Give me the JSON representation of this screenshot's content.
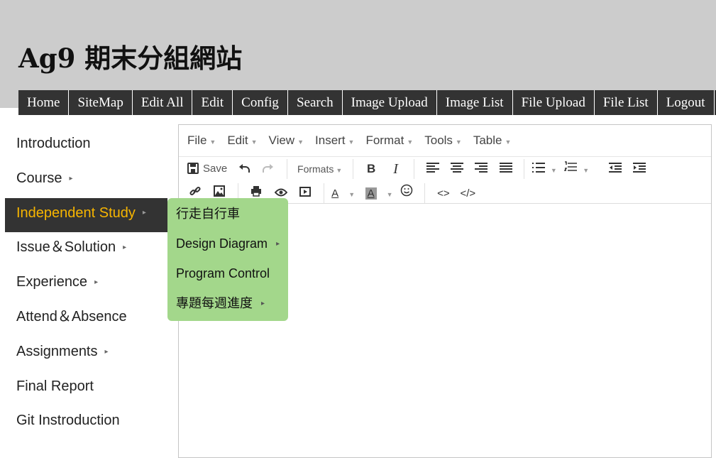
{
  "header": {
    "title": "Ag9 期末分組網站"
  },
  "topnav": [
    "Home",
    "SiteMap",
    "Edit All",
    "Edit",
    "Config",
    "Search",
    "Image Upload",
    "Image List",
    "File Upload",
    "File List",
    "Logout"
  ],
  "sidebar": {
    "items": [
      {
        "label": "Introduction",
        "has_sub": false
      },
      {
        "label": "Course",
        "has_sub": true
      },
      {
        "label": "Independent Study",
        "has_sub": true,
        "active": true
      },
      {
        "label": "Issue＆Solution",
        "has_sub": true
      },
      {
        "label": "Experience",
        "has_sub": true
      },
      {
        "label": "Attend＆Absence",
        "has_sub": false
      },
      {
        "label": "Assignments",
        "has_sub": true
      },
      {
        "label": "Final Report",
        "has_sub": false
      },
      {
        "label": "Git Instroduction",
        "has_sub": false
      }
    ]
  },
  "submenu": {
    "items": [
      {
        "label": "行走自行車",
        "has_sub": false
      },
      {
        "label": "Design Diagram",
        "has_sub": true
      },
      {
        "label": "Program Control",
        "has_sub": false
      },
      {
        "label": "專題每週進度",
        "has_sub": true
      }
    ]
  },
  "editor": {
    "menubar": [
      "File",
      "Edit",
      "View",
      "Insert",
      "Format",
      "Tools",
      "Table"
    ],
    "save_label": "Save",
    "formats_label": "Formats",
    "icons": {
      "save": "save-icon",
      "undo": "undo-icon",
      "redo": "redo-icon",
      "bold": "bold-icon",
      "italic": "italic-icon",
      "align_left": "align-left-icon",
      "align_center": "align-center-icon",
      "align_right": "align-right-icon",
      "align_justify": "align-justify-icon",
      "bullet_list": "bullet-list-icon",
      "numbered_list": "numbered-list-icon",
      "outdent": "outdent-icon",
      "indent": "indent-icon",
      "link": "link-icon",
      "image": "image-icon",
      "print": "print-icon",
      "preview": "preview-icon",
      "media": "media-icon",
      "text_color": "text-color-icon",
      "background_color": "background-color-icon",
      "emoticons": "emoticons-icon",
      "code_sample": "code-sample-icon",
      "source_code": "source-code-icon"
    }
  },
  "colors": {
    "header_bg": "#cccccc",
    "nav_bg": "#333333",
    "active_text": "#f7b500",
    "submenu_bg": "#a3d78b"
  }
}
